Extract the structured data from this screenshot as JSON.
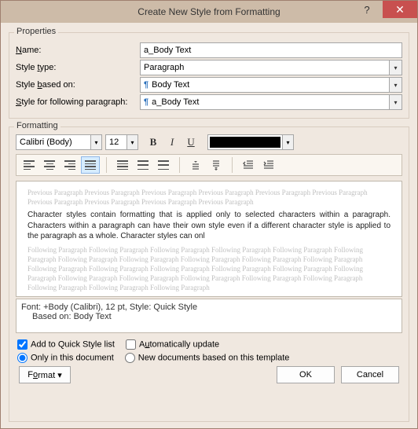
{
  "title": "Create New Style from Formatting",
  "properties": {
    "group_label": "Properties",
    "name_label": "Name:",
    "name_value": "a_Body Text",
    "type_label": "Style type:",
    "type_value": "Paragraph",
    "based_label": "Style based on:",
    "based_value": "Body Text",
    "following_label": "Style for following paragraph:",
    "following_value": "a_Body Text"
  },
  "formatting": {
    "group_label": "Formatting",
    "font": "Calibri (Body)",
    "size": "12",
    "preview_prev": "Previous Paragraph Previous Paragraph Previous Paragraph Previous Paragraph Previous Paragraph Previous Paragraph Previous Paragraph Previous Paragraph Previous Paragraph Previous Paragraph",
    "preview_body": "Character styles contain formatting that is applied only to selected characters within a paragraph. Characters within a paragraph can have their own style even if a different character style is applied to the paragraph as a whole. Character styles can onl",
    "preview_follow": "Following Paragraph Following Paragraph Following Paragraph Following Paragraph Following Paragraph Following Paragraph Following Paragraph Following Paragraph Following Paragraph Following Paragraph Following Paragraph Following Paragraph Following Paragraph Following Paragraph Following Paragraph Following Paragraph Following Paragraph Following Paragraph Following Paragraph Following Paragraph Following Paragraph Following Paragraph Following Paragraph Following Paragraph Following Paragraph",
    "desc_line1": "Font: +Body (Calibri), 12 pt, Style: Quick Style",
    "desc_line2": "Based on: Body Text"
  },
  "options": {
    "add_quick": "Add to Quick Style list",
    "auto_update": "Automatically update",
    "only_doc": "Only in this document",
    "new_docs": "New documents based on this template"
  },
  "buttons": {
    "format": "Format ▾",
    "ok": "OK",
    "cancel": "Cancel"
  }
}
